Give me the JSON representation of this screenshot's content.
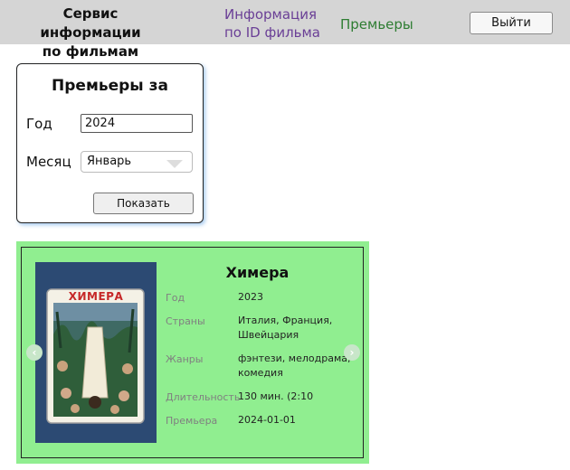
{
  "header": {
    "brand_line1": "Сервис информации",
    "brand_line2": "по фильмам",
    "nav_by_id_line1": "Информация",
    "nav_by_id_line2": "по ID фильма",
    "nav_premieres": "Премьеры",
    "logout_label": "Выйти"
  },
  "form": {
    "title": "Премьеры за",
    "year_label": "Год",
    "year_value": "2024",
    "month_label": "Месяц",
    "month_value": "Январь",
    "submit_label": "Показать"
  },
  "film": {
    "title": "Химера",
    "poster_text": "ХИМЕРА",
    "fields": [
      {
        "label": "Год",
        "value": "2023"
      },
      {
        "label": "Страны",
        "value": "Италия, Франция, Швейцария"
      },
      {
        "label": "Жанры",
        "value": "фэнтези, мелодрама, комедия"
      },
      {
        "label": "Длительность",
        "value": "130 мин. (2:10"
      },
      {
        "label": "Премьера",
        "value": "2024-01-01"
      }
    ],
    "prev_icon": "chevron-left-icon",
    "next_icon": "chevron-right-icon"
  },
  "colors": {
    "header_bg": "#d5d5d5",
    "nav_link": "#6a3f96",
    "nav_active": "#2e7d32",
    "carousel_bg": "#90ee90"
  }
}
